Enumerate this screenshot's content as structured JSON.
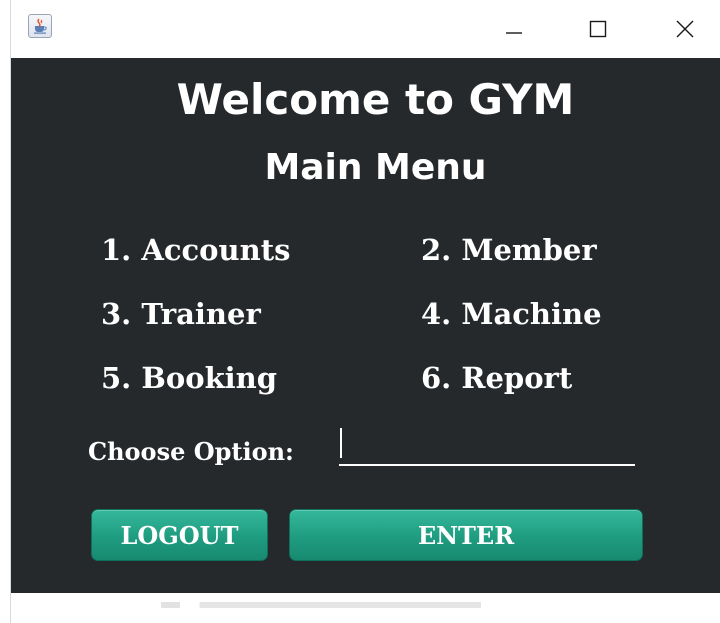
{
  "window": {
    "icon": "java-cup-icon",
    "controls": {
      "minimize": "—",
      "maximize": "☐",
      "close": "✕"
    }
  },
  "header": {
    "title": "Welcome to GYM",
    "subtitle": "Main Menu"
  },
  "menu": {
    "items": [
      "1. Accounts",
      "2. Member",
      "3. Trainer",
      "4. Machine",
      "5. Booking",
      "6. Report"
    ]
  },
  "form": {
    "label": "Choose Option:",
    "value": ""
  },
  "buttons": {
    "logout": "LOGOUT",
    "enter": "ENTER"
  },
  "colors": {
    "background": "#25292b",
    "button": "#1f9c80",
    "text": "#ffffff"
  }
}
